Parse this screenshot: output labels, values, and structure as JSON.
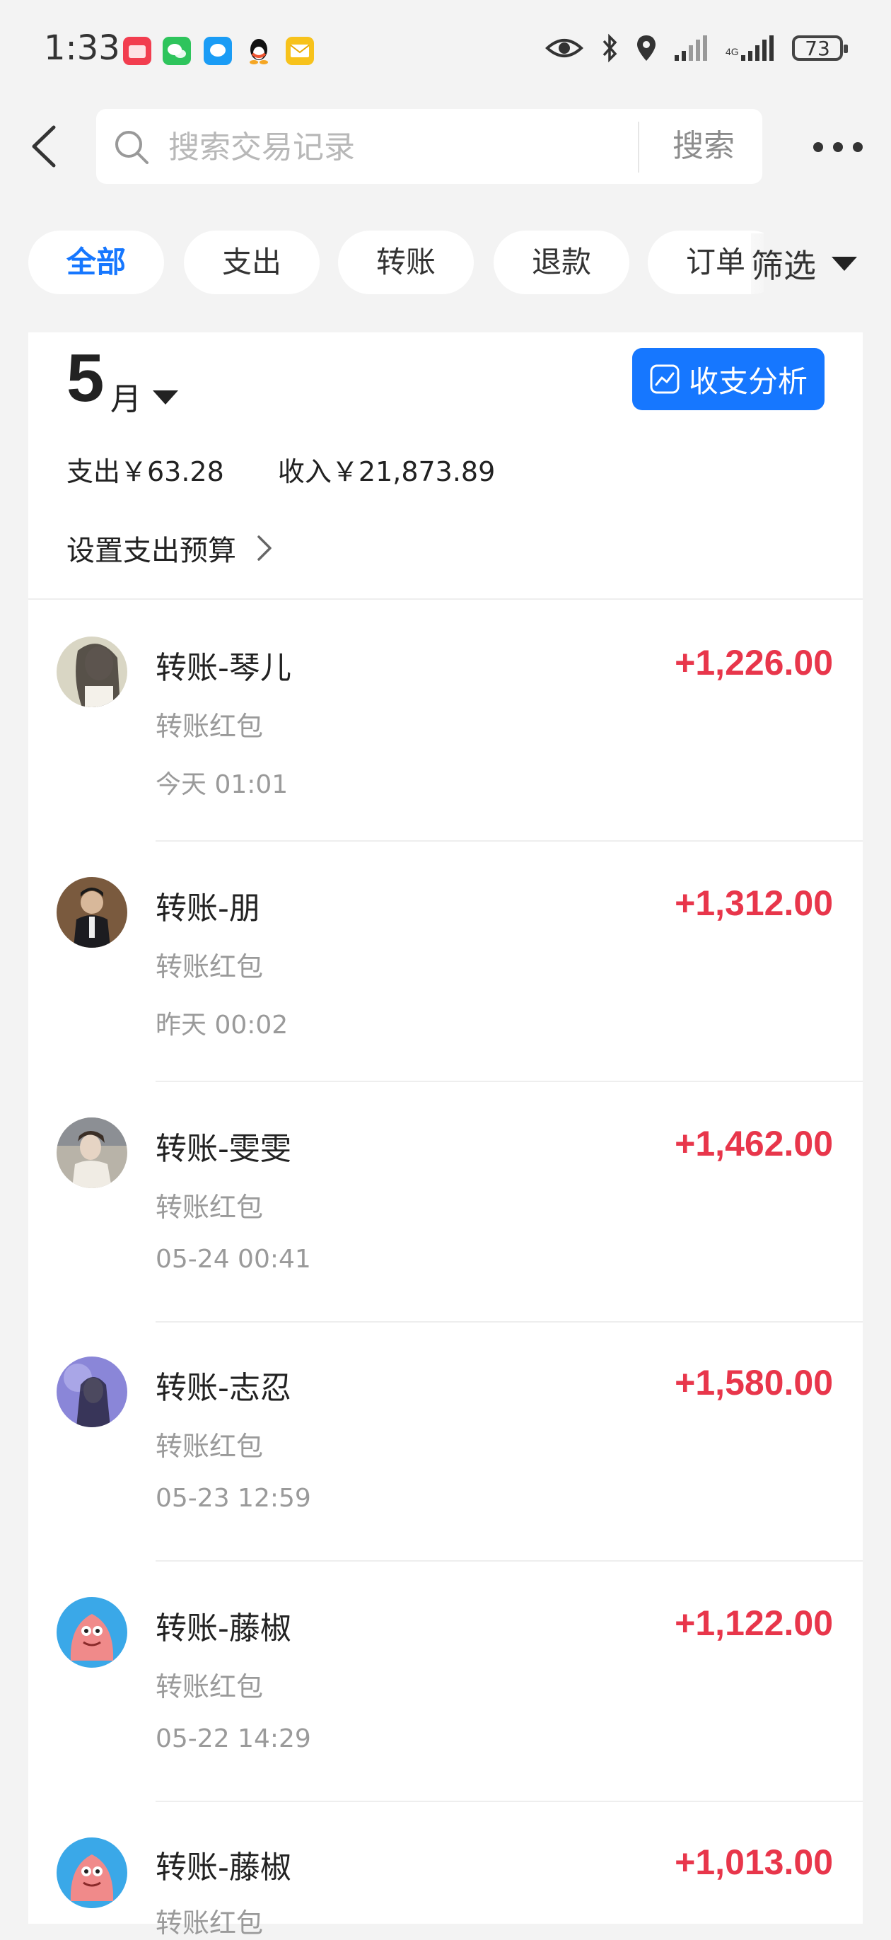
{
  "status_bar": {
    "time": "1:33",
    "battery": "73",
    "left_icons": [
      "huawei-store-icon",
      "wechat-icon",
      "messages-icon",
      "qq-icon",
      "mail-icon"
    ],
    "right_icons": [
      "eye-icon",
      "bluetooth-icon",
      "location-icon",
      "signal-icon",
      "signal-icon-2"
    ]
  },
  "header": {
    "search_placeholder": "搜索交易记录",
    "search_button": "搜索"
  },
  "tabs": [
    {
      "label": "全部",
      "active": true
    },
    {
      "label": "支出",
      "active": false
    },
    {
      "label": "转账",
      "active": false
    },
    {
      "label": "退款",
      "active": false
    },
    {
      "label": "订单",
      "active": false
    }
  ],
  "filter": {
    "label": "筛选"
  },
  "summary": {
    "month": "5",
    "month_unit": "月",
    "analysis_button": "收支分析",
    "expense": "支出￥63.28",
    "income": "收入￥21,873.89",
    "budget_link": "设置支出预算"
  },
  "transactions": [
    {
      "title": "转账-琴儿",
      "subtitle": "转账红包",
      "time": "今天 01:01",
      "amount": "+1,226.00",
      "avatar": "woman-portrait"
    },
    {
      "title": "转账-朋",
      "subtitle": "转账红包",
      "time": "昨天 00:02",
      "amount": "+1,312.00",
      "avatar": "man-portrait"
    },
    {
      "title": "转账-雯雯",
      "subtitle": "转账红包",
      "time": "05-24 00:41",
      "amount": "+1,462.00",
      "avatar": "girl-portrait"
    },
    {
      "title": "转账-志忍",
      "subtitle": "转账红包",
      "time": "05-23 12:59",
      "amount": "+1,580.00",
      "avatar": "purple-portrait"
    },
    {
      "title": "转账-藤椒",
      "subtitle": "转账红包",
      "time": "05-22 14:29",
      "amount": "+1,122.00",
      "avatar": "patrick-star"
    },
    {
      "title": "转账-藤椒",
      "subtitle": "转账红包",
      "time": "",
      "amount": "+1,013.00",
      "avatar": "patrick-star"
    }
  ],
  "colors": {
    "accent": "#1677ff",
    "income_amount": "#e8364b",
    "background": "#f3f3f3"
  }
}
